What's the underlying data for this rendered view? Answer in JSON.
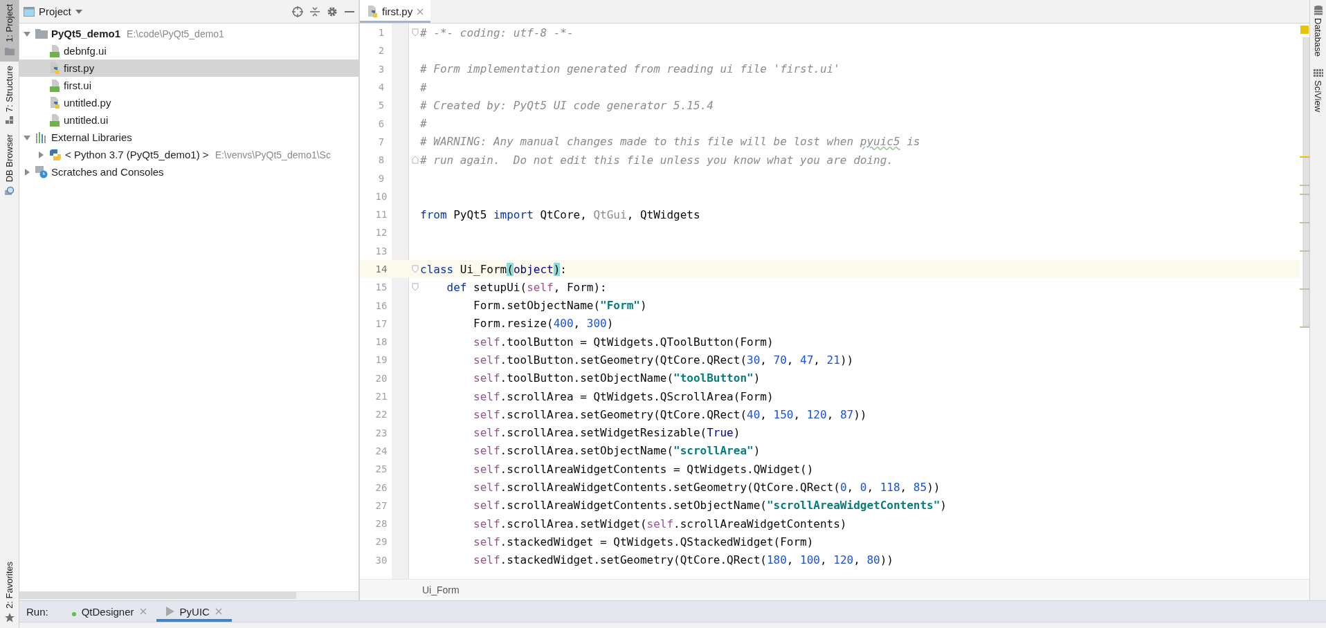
{
  "left_tool_tabs": [
    {
      "label": "1: Project",
      "kind": "project",
      "selected": true
    },
    {
      "label": "7: Structure",
      "kind": "structure",
      "selected": false
    },
    {
      "label": "DB Browser",
      "kind": "db",
      "selected": false
    }
  ],
  "left_bottom_tab": {
    "label": "2: Favorites"
  },
  "project_panel": {
    "title": "Project",
    "tree": [
      {
        "name": "PyQt5_demo1",
        "path": "E:\\code\\PyQt5_demo1",
        "kind": "folder",
        "expanded": true,
        "selected": false,
        "children": [
          {
            "name": "debnfg.ui",
            "kind": "ui",
            "selected": false
          },
          {
            "name": "first.py",
            "kind": "py",
            "selected": true
          },
          {
            "name": "first.ui",
            "kind": "ui",
            "selected": false
          },
          {
            "name": "untitled.py",
            "kind": "py",
            "selected": false
          },
          {
            "name": "untitled.ui",
            "kind": "ui",
            "selected": false
          }
        ]
      },
      {
        "name": "External Libraries",
        "kind": "library",
        "expanded": true,
        "selected": false,
        "children": [
          {
            "name": "< Python 3.7 (PyQt5_demo1) >",
            "path": "E:\\venvs\\PyQt5_demo1\\Sc",
            "kind": "python",
            "expanded": false,
            "selected": false
          }
        ]
      },
      {
        "name": "Scratches and Consoles",
        "kind": "scratch",
        "expanded": false,
        "selected": false
      }
    ]
  },
  "editor": {
    "tabs": [
      {
        "label": "first.py",
        "selected": true
      }
    ],
    "lines": [
      {
        "number": "1",
        "fold": true,
        "current": false,
        "tokens": [
          {
            "kind": "comment",
            "text": "# -*- coding: utf-8 -*-"
          }
        ]
      },
      {
        "number": "2",
        "fold": false,
        "current": false
      },
      {
        "number": "3",
        "fold": false,
        "current": false,
        "tokens": [
          {
            "kind": "comment",
            "text": "# Form implementation generated from reading ui file 'first.ui'"
          }
        ]
      },
      {
        "number": "4",
        "fold": false,
        "current": false,
        "tokens": [
          {
            "kind": "comment",
            "text": "#"
          }
        ]
      },
      {
        "number": "5",
        "fold": false,
        "current": false,
        "tokens": [
          {
            "kind": "comment",
            "text": "# Created by: PyQt5 UI code generator 5.15.4"
          }
        ]
      },
      {
        "number": "6",
        "fold": false,
        "current": false,
        "tokens": [
          {
            "kind": "comment",
            "text": "#"
          }
        ]
      },
      {
        "number": "7",
        "fold": false,
        "current": false,
        "tokens": [
          {
            "kind": "comment",
            "text": "# WARNING: Any manual changes made to this file will be lost when "
          },
          {
            "kind": "typo",
            "text": "pyuic5"
          },
          {
            "kind": "comment",
            "text": " is"
          }
        ]
      },
      {
        "number": "8",
        "fold": true,
        "current": false,
        "tokens": [
          {
            "kind": "comment",
            "text": "# run again.  Do not edit this file unless you know what you are doing."
          }
        ]
      },
      {
        "number": "9",
        "fold": false,
        "current": false
      },
      {
        "number": "10",
        "fold": false,
        "current": false
      },
      {
        "number": "11",
        "fold": false,
        "current": false,
        "tokens": [
          {
            "kind": "keyword",
            "text": "from"
          },
          {
            "kind": "plain",
            "text": " PyQt5 "
          },
          {
            "kind": "keyword",
            "text": "import"
          },
          {
            "kind": "plain",
            "text": " QtCore, "
          },
          {
            "kind": "unused",
            "text": "QtGui"
          },
          {
            "kind": "plain",
            "text": ", QtWidgets"
          }
        ]
      },
      {
        "number": "12",
        "fold": false,
        "current": false
      },
      {
        "number": "13",
        "fold": false,
        "current": false
      },
      {
        "number": "14",
        "fold": true,
        "current": true,
        "tokens": [
          {
            "kind": "keyword",
            "text": "class"
          },
          {
            "kind": "plain",
            "text": " Ui_Form"
          },
          {
            "kind": "bracket",
            "text": "("
          },
          {
            "kind": "builtin",
            "text": "object"
          },
          {
            "kind": "bracket",
            "text": ")"
          },
          {
            "kind": "plain",
            "text": ":"
          }
        ]
      },
      {
        "number": "15",
        "fold": true,
        "current": false,
        "tokens": [
          {
            "kind": "keyword",
            "text": "    def"
          },
          {
            "kind": "plain",
            "text": " setupUi("
          },
          {
            "kind": "self",
            "text": "self"
          },
          {
            "kind": "plain",
            "text": ", Form):"
          }
        ]
      },
      {
        "number": "16",
        "fold": false,
        "current": false,
        "tokens": [
          {
            "kind": "plain",
            "text": "        Form.setObjectName("
          },
          {
            "kind": "string",
            "text": "\"Form\""
          },
          {
            "kind": "plain",
            "text": ")"
          }
        ]
      },
      {
        "number": "17",
        "fold": false,
        "current": false,
        "tokens": [
          {
            "kind": "plain",
            "text": "        Form.resize("
          },
          {
            "kind": "number",
            "text": "400"
          },
          {
            "kind": "plain",
            "text": ", "
          },
          {
            "kind": "number",
            "text": "300"
          },
          {
            "kind": "plain",
            "text": ")"
          }
        ]
      },
      {
        "number": "18",
        "fold": false,
        "current": false,
        "tokens": [
          {
            "kind": "self",
            "text": "        self"
          },
          {
            "kind": "plain",
            "text": ".toolButton = QtWidgets.QToolButton(Form)"
          }
        ]
      },
      {
        "number": "19",
        "fold": false,
        "current": false,
        "tokens": [
          {
            "kind": "self",
            "text": "        self"
          },
          {
            "kind": "plain",
            "text": ".toolButton.setGeometry(QtCore.QRect("
          },
          {
            "kind": "number",
            "text": "30"
          },
          {
            "kind": "plain",
            "text": ", "
          },
          {
            "kind": "number",
            "text": "70"
          },
          {
            "kind": "plain",
            "text": ", "
          },
          {
            "kind": "number",
            "text": "47"
          },
          {
            "kind": "plain",
            "text": ", "
          },
          {
            "kind": "number",
            "text": "21"
          },
          {
            "kind": "plain",
            "text": "))"
          }
        ]
      },
      {
        "number": "20",
        "fold": false,
        "current": false,
        "tokens": [
          {
            "kind": "self",
            "text": "        self"
          },
          {
            "kind": "plain",
            "text": ".toolButton.setObjectName("
          },
          {
            "kind": "string",
            "text": "\"toolButton\""
          },
          {
            "kind": "plain",
            "text": ")"
          }
        ]
      },
      {
        "number": "21",
        "fold": false,
        "current": false,
        "tokens": [
          {
            "kind": "self",
            "text": "        self"
          },
          {
            "kind": "plain",
            "text": ".scrollArea = QtWidgets.QScrollArea(Form)"
          }
        ]
      },
      {
        "number": "22",
        "fold": false,
        "current": false,
        "tokens": [
          {
            "kind": "self",
            "text": "        self"
          },
          {
            "kind": "plain",
            "text": ".scrollArea.setGeometry(QtCore.QRect("
          },
          {
            "kind": "number",
            "text": "40"
          },
          {
            "kind": "plain",
            "text": ", "
          },
          {
            "kind": "number",
            "text": "150"
          },
          {
            "kind": "plain",
            "text": ", "
          },
          {
            "kind": "number",
            "text": "120"
          },
          {
            "kind": "plain",
            "text": ", "
          },
          {
            "kind": "number",
            "text": "87"
          },
          {
            "kind": "plain",
            "text": "))"
          }
        ]
      },
      {
        "number": "23",
        "fold": false,
        "current": false,
        "tokens": [
          {
            "kind": "self",
            "text": "        self"
          },
          {
            "kind": "plain",
            "text": ".scrollArea.setWidgetResizable("
          },
          {
            "kind": "builtin",
            "text": "True"
          },
          {
            "kind": "plain",
            "text": ")"
          }
        ]
      },
      {
        "number": "24",
        "fold": false,
        "current": false,
        "tokens": [
          {
            "kind": "self",
            "text": "        self"
          },
          {
            "kind": "plain",
            "text": ".scrollArea.setObjectName("
          },
          {
            "kind": "string",
            "text": "\"scrollArea\""
          },
          {
            "kind": "plain",
            "text": ")"
          }
        ]
      },
      {
        "number": "25",
        "fold": false,
        "current": false,
        "tokens": [
          {
            "kind": "self",
            "text": "        self"
          },
          {
            "kind": "plain",
            "text": ".scrollAreaWidgetContents = QtWidgets.QWidget()"
          }
        ]
      },
      {
        "number": "26",
        "fold": false,
        "current": false,
        "tokens": [
          {
            "kind": "self",
            "text": "        self"
          },
          {
            "kind": "plain",
            "text": ".scrollAreaWidgetContents.setGeometry(QtCore.QRect("
          },
          {
            "kind": "number",
            "text": "0"
          },
          {
            "kind": "plain",
            "text": ", "
          },
          {
            "kind": "number",
            "text": "0"
          },
          {
            "kind": "plain",
            "text": ", "
          },
          {
            "kind": "number",
            "text": "118"
          },
          {
            "kind": "plain",
            "text": ", "
          },
          {
            "kind": "number",
            "text": "85"
          },
          {
            "kind": "plain",
            "text": "))"
          }
        ]
      },
      {
        "number": "27",
        "fold": false,
        "current": false,
        "tokens": [
          {
            "kind": "self",
            "text": "        self"
          },
          {
            "kind": "plain",
            "text": ".scrollAreaWidgetContents.setObjectName("
          },
          {
            "kind": "string",
            "text": "\"scrollAreaWidgetContents\""
          },
          {
            "kind": "plain",
            "text": ")"
          }
        ]
      },
      {
        "number": "28",
        "fold": false,
        "current": false,
        "tokens": [
          {
            "kind": "self",
            "text": "        self"
          },
          {
            "kind": "plain",
            "text": ".scrollArea.setWidget("
          },
          {
            "kind": "self",
            "text": "self"
          },
          {
            "kind": "plain",
            "text": ".scrollAreaWidgetContents)"
          }
        ]
      },
      {
        "number": "29",
        "fold": false,
        "current": false,
        "tokens": [
          {
            "kind": "self",
            "text": "        self"
          },
          {
            "kind": "plain",
            "text": ".stackedWidget = QtWidgets.QStackedWidget(Form)"
          }
        ]
      },
      {
        "number": "30",
        "fold": false,
        "current": false,
        "tokens": [
          {
            "kind": "self",
            "text": "        self"
          },
          {
            "kind": "plain",
            "text": ".stackedWidget.setGeometry(QtCore.QRect("
          },
          {
            "kind": "number",
            "text": "180"
          },
          {
            "kind": "plain",
            "text": ", "
          },
          {
            "kind": "number",
            "text": "100"
          },
          {
            "kind": "plain",
            "text": ", "
          },
          {
            "kind": "number",
            "text": "120"
          },
          {
            "kind": "plain",
            "text": ", "
          },
          {
            "kind": "number",
            "text": "80"
          },
          {
            "kind": "plain",
            "text": "))"
          }
        ]
      }
    ],
    "breadcrumb": "Ui_Form"
  },
  "right_tool_tabs": [
    {
      "label": "Database",
      "kind": "database"
    },
    {
      "label": "SciView",
      "kind": "sciview"
    }
  ],
  "run_bar": {
    "label": "Run:",
    "tabs": [
      {
        "label": "QtDesigner",
        "running": true,
        "selected": false
      },
      {
        "label": "PyUIC",
        "running": false,
        "selected": true
      }
    ]
  }
}
